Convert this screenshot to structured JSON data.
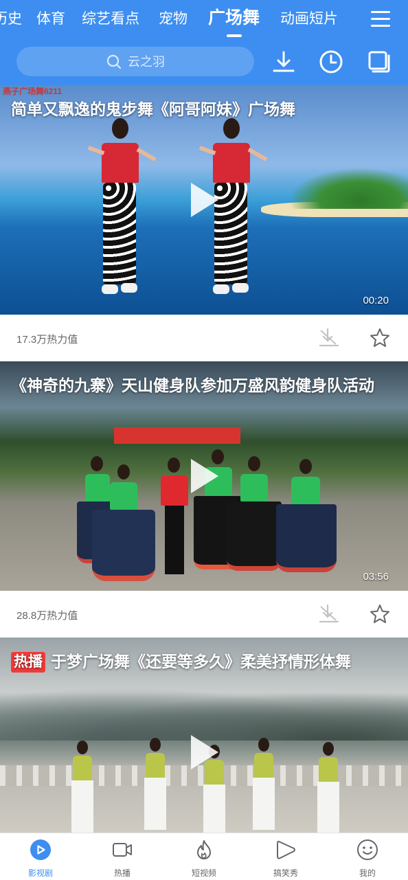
{
  "header": {
    "tabs": [
      {
        "label": "历史"
      },
      {
        "label": "体育"
      },
      {
        "label": "综艺看点"
      },
      {
        "label": "宠物"
      },
      {
        "label": "广场舞",
        "active": true
      },
      {
        "label": "动画短片"
      }
    ],
    "search_placeholder": "云之羽",
    "icons": [
      "menu-icon",
      "download-icon",
      "history-clock-icon",
      "multi-window-icon"
    ]
  },
  "feed": [
    {
      "title": "简单又飘逸的鬼步舞《阿哥阿妹》广场舞",
      "duration": "00:20",
      "heat": "17.3万热力值",
      "watermark": "燕子广场舞6211"
    },
    {
      "title": "《神奇的九寨》天山健身队参加万盛风韵健身队活动",
      "duration": "03:56",
      "heat": "28.8万热力值"
    },
    {
      "badge": "热播",
      "title": "于梦广场舞《还要等多久》柔美抒情形体舞"
    }
  ],
  "bottom_nav": [
    {
      "label": "影视剧",
      "icon": "play-circle-icon",
      "active": true
    },
    {
      "label": "热播",
      "icon": "video-camera-icon"
    },
    {
      "label": "短视频",
      "icon": "flame-icon"
    },
    {
      "label": "搞笑秀",
      "icon": "play-bubble-icon"
    },
    {
      "label": "我的",
      "icon": "smiley-icon"
    }
  ],
  "colors": {
    "brand": "#3d8ef0",
    "badge": "#f23a3a"
  }
}
